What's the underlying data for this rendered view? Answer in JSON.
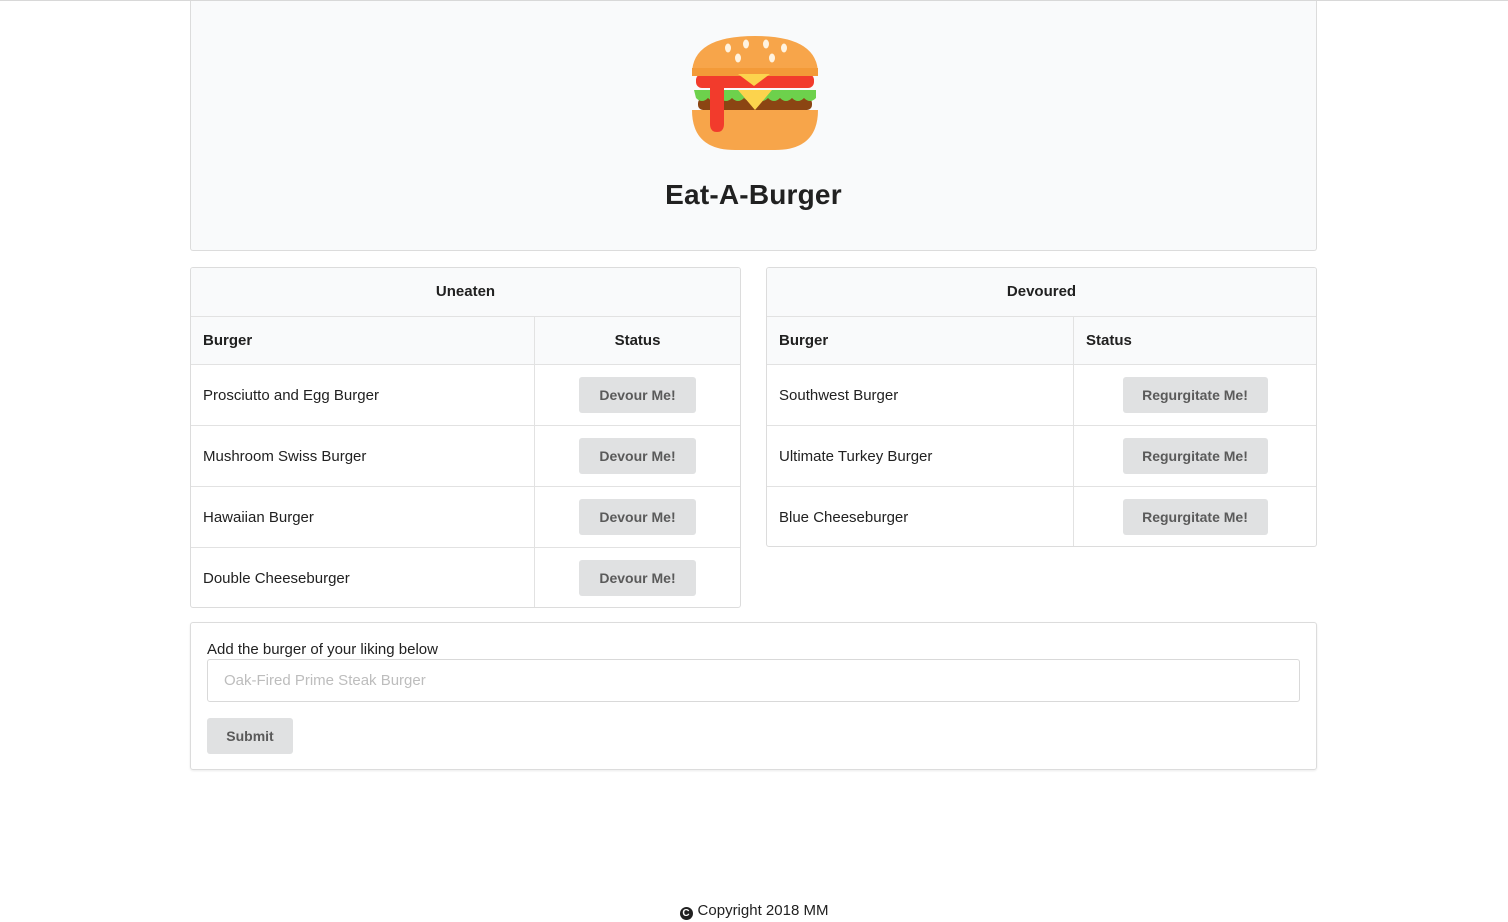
{
  "header": {
    "title": "Eat-A-Burger",
    "logo_icon": "burger-icon"
  },
  "uneaten": {
    "title": "Uneaten",
    "columns": {
      "burger": "Burger",
      "status": "Status"
    },
    "rows": [
      {
        "name": "Prosciutto and Egg Burger",
        "action": "Devour Me!"
      },
      {
        "name": "Mushroom Swiss Burger",
        "action": "Devour Me!"
      },
      {
        "name": "Hawaiian Burger",
        "action": "Devour Me!"
      },
      {
        "name": "Double Cheeseburger",
        "action": "Devour Me!"
      }
    ]
  },
  "devoured": {
    "title": "Devoured",
    "columns": {
      "burger": "Burger",
      "status": "Status"
    },
    "rows": [
      {
        "name": "Southwest Burger",
        "action": "Regurgitate Me!"
      },
      {
        "name": "Ultimate Turkey Burger",
        "action": "Regurgitate Me!"
      },
      {
        "name": "Blue Cheeseburger",
        "action": "Regurgitate Me!"
      }
    ]
  },
  "form": {
    "label": "Add the burger of your liking below",
    "placeholder": "Oak-Fired Prime Steak Burger",
    "value": "",
    "submit_label": "Submit"
  },
  "footer": {
    "icon": "copyright-icon",
    "text": "Copyright 2018 MM"
  },
  "colors": {
    "button_bg": "#e0e1e2",
    "panel_header_bg": "#f9fafb",
    "bun": "#f7a54a",
    "ketchup": "#f23b2c",
    "lettuce": "#6dd14c",
    "cheese": "#fcd34d",
    "patty": "#8b4513"
  }
}
